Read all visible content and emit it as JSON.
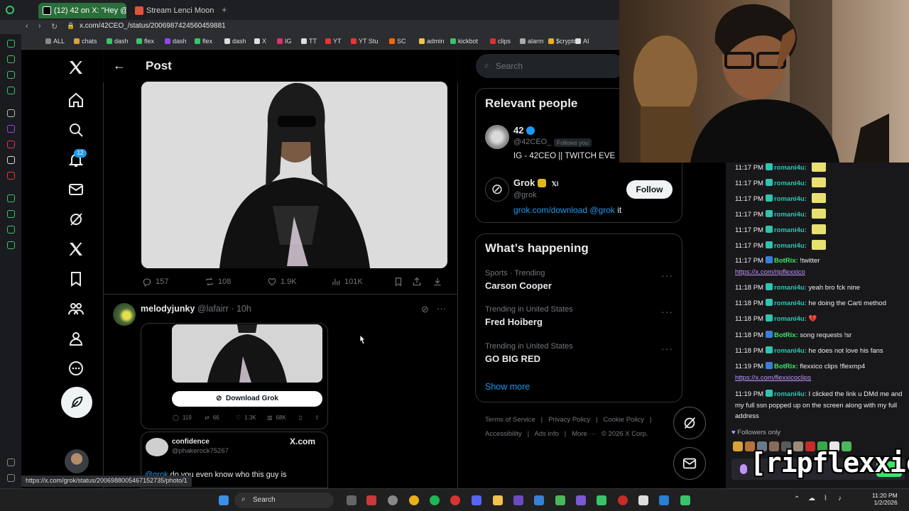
{
  "browser": {
    "tabs": [
      {
        "label": "(12) 42 on X: \"Hey @grok",
        "active": true
      },
      {
        "label": "Stream Lenci Moon | Liste",
        "active": false
      }
    ],
    "new_tab": "+",
    "url": "x.com/42CEO_/status/2006987424560459881",
    "bookmarks": [
      "ALL",
      "chats",
      "dash",
      "flex",
      "dash",
      "flex",
      "dash",
      "X",
      "IG",
      "TT",
      "YT",
      "YT Stu",
      "SC",
      "admin",
      "kickbot",
      "clips",
      "alarm",
      "$crypto",
      "AI"
    ],
    "status_url": "https://x.com/grok/status/2006988005467152735/photo/1"
  },
  "nav": {
    "notifications_badge": "12"
  },
  "post": {
    "header_title": "Post",
    "stats": {
      "replies": "157",
      "reposts": "108",
      "likes": "1.9K",
      "views": "101K"
    }
  },
  "reply": {
    "name": "melodyjunky",
    "handle": "@lafairr",
    "time": "· 10h",
    "download_label": "Download Grok",
    "stats": {
      "replies": "119",
      "reposts": "66",
      "likes": "1.3K",
      "views": "68K"
    },
    "quote_name": "confidence",
    "quote_handle": "@phakerock75267",
    "quote_source": "X.com",
    "quote_text": "do you even know who this guy is",
    "quote_mention": "@grok"
  },
  "sidebar": {
    "search_placeholder": "Search",
    "relevant_title": "Relevant people",
    "people": [
      {
        "name": "42",
        "handle": "@42CEO_",
        "follows_you": "Follows you",
        "bio": "IG - 42CEO || TWITCH EVE"
      },
      {
        "name": "Grok",
        "handle": "@grok",
        "tag": "𝕏I",
        "bio_link": "grok.com/download @grok",
        "bio_tail": " it",
        "follow": "Follow"
      }
    ],
    "happening_title": "What’s happening",
    "trends": [
      {
        "meta": "Sports · Trending",
        "title": "Carson Cooper"
      },
      {
        "meta": "Trending in United States",
        "title": "Fred Hoiberg"
      },
      {
        "meta": "Trending in United States",
        "title": "GO BIG RED"
      }
    ],
    "show_more": "Show more",
    "footer": [
      "Terms of Service",
      "|",
      "Privacy Policy",
      "|",
      "Cookie Policy",
      "|",
      "Accessibility",
      "|",
      "Ads info",
      "|",
      "More ···",
      "© 2026 X Corp."
    ]
  },
  "chat": {
    "messages": [
      {
        "time": "11:17 PM",
        "user": "romani4u:",
        "text": "",
        "emote": true
      },
      {
        "time": "11:17 PM",
        "user": "romani4u:",
        "text": "",
        "emote": true
      },
      {
        "time": "11:17 PM",
        "user": "romani4u:",
        "text": "",
        "emote": true
      },
      {
        "time": "11:17 PM",
        "user": "romani4u:",
        "text": "",
        "emote": true
      },
      {
        "time": "11:17 PM",
        "user": "romani4u:",
        "text": "",
        "emote": true
      },
      {
        "time": "11:17 PM",
        "user": "romani4u:",
        "text": "",
        "emote": true
      },
      {
        "time": "11:17 PM",
        "user": "BotRix:",
        "text": "!twitter",
        "link": "https://x.com/ripflexxico"
      },
      {
        "time": "11:18 PM",
        "user": "romani4u:",
        "text": "yeah bro fck nine"
      },
      {
        "time": "11:18 PM",
        "user": "romani4u:",
        "text": "he doing the Carti method"
      },
      {
        "time": "11:18 PM",
        "user": "romani4u:",
        "text": "💔"
      },
      {
        "time": "11:18 PM",
        "user": "BotRix:",
        "text": "song requests !sr"
      },
      {
        "time": "11:18 PM",
        "user": "romani4u:",
        "text": "he does not love his fans"
      },
      {
        "time": "11:19 PM",
        "user": "BotRix:",
        "text": "flexxico clips !flexmp4",
        "link": "https://x.com/flexxicoclips"
      },
      {
        "time": "11:19 PM",
        "user": "romani4u:",
        "text": "I clicked the link u DMd me and my full ssn popped up on the screen along with my full address"
      }
    ],
    "followers_only": "Followers only",
    "overlay": "[ripflexxico]"
  },
  "taskbar": {
    "search": "Search",
    "time": "11:20 PM",
    "date": "1/2/2026"
  },
  "colors": {
    "accent": "#1d9bf0",
    "chat_user": "#2fc3b0",
    "bot": "#39e66a",
    "link": "#bf94ff"
  }
}
